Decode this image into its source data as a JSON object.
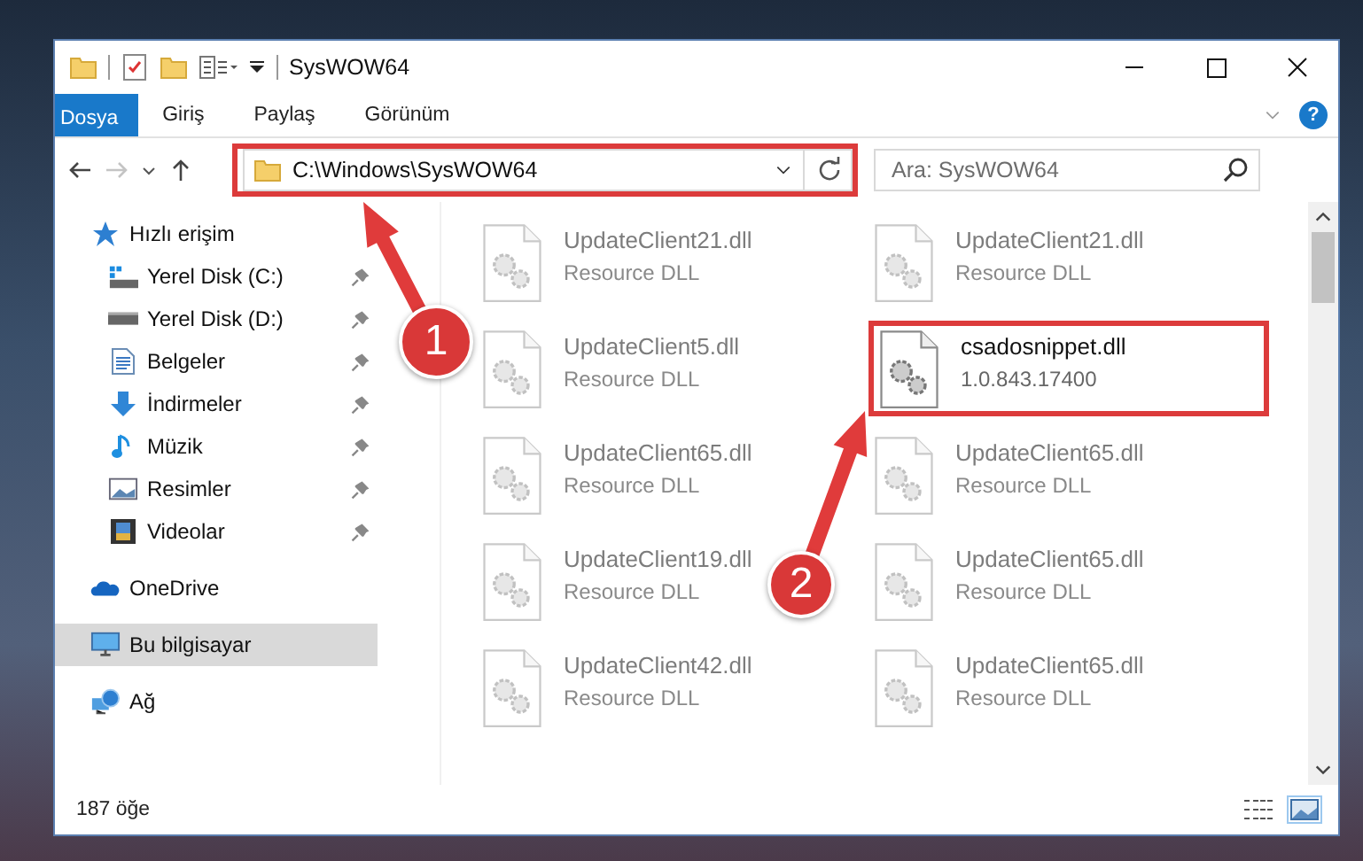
{
  "window": {
    "title": "SysWOW64"
  },
  "ribbon": {
    "tabs": [
      {
        "label": "Dosya",
        "kind": "file",
        "selected": false
      },
      {
        "label": "Giriş",
        "kind": "tab",
        "selected": false
      },
      {
        "label": "Paylaş",
        "kind": "tab",
        "selected": false
      },
      {
        "label": "Görünüm",
        "kind": "tab",
        "selected": false
      }
    ],
    "help_label": "?"
  },
  "address_bar": {
    "path": "C:\\Windows\\SysWOW64",
    "highlighted": true,
    "forward_disabled": true
  },
  "search": {
    "placeholder": "Ara: SysWOW64"
  },
  "sidebar": {
    "items": [
      {
        "label": "Hızlı erişim",
        "kind": "star",
        "selected": false,
        "children": [
          {
            "label": "Yerel Disk (C:)",
            "kind": "drive-c",
            "pinned": true,
            "selected": false
          },
          {
            "label": "Yerel Disk (D:)",
            "kind": "drive",
            "pinned": true,
            "selected": false
          },
          {
            "label": "Belgeler",
            "kind": "document",
            "pinned": true,
            "selected": false
          },
          {
            "label": "İndirmeler",
            "kind": "download",
            "pinned": true,
            "selected": false
          },
          {
            "label": "Müzik",
            "kind": "music",
            "pinned": true,
            "selected": false
          },
          {
            "label": "Resimler",
            "kind": "picture",
            "pinned": true,
            "selected": false
          },
          {
            "label": "Videolar",
            "kind": "video",
            "pinned": true,
            "selected": false
          }
        ]
      },
      {
        "label": "OneDrive",
        "kind": "cloud",
        "selected": false
      },
      {
        "label": "Bu bilgisayar",
        "kind": "computer",
        "selected": true
      },
      {
        "label": "Ağ",
        "kind": "network",
        "selected": false
      }
    ]
  },
  "files": [
    {
      "name": "UpdateClient21.dll",
      "detail": "Resource DLL",
      "blurred": true,
      "highlighted": false
    },
    {
      "name": "UpdateClient21.dll",
      "detail": "Resource DLL",
      "blurred": true,
      "highlighted": false
    },
    {
      "name": "UpdateClient5.dll",
      "detail": "Resource DLL",
      "blurred": true,
      "highlighted": false
    },
    {
      "name": "csadosnippet.dll",
      "detail": "1.0.843.17400",
      "blurred": false,
      "highlighted": true
    },
    {
      "name": "UpdateClient65.dll",
      "detail": "Resource DLL",
      "blurred": true,
      "highlighted": false
    },
    {
      "name": "UpdateClient65.dll",
      "detail": "Resource DLL",
      "blurred": true,
      "highlighted": false
    },
    {
      "name": "UpdateClient19.dll",
      "detail": "Resource DLL",
      "blurred": true,
      "highlighted": false
    },
    {
      "name": "UpdateClient65.dll",
      "detail": "Resource DLL",
      "blurred": true,
      "highlighted": false
    },
    {
      "name": "UpdateClient42.dll",
      "detail": "Resource DLL",
      "blurred": true,
      "highlighted": false
    },
    {
      "name": "UpdateClient65.dll",
      "detail": "Resource DLL",
      "blurred": true,
      "highlighted": false
    }
  ],
  "status_bar": {
    "count": "187 öğe"
  },
  "callouts": [
    {
      "number": "1"
    },
    {
      "number": "2"
    }
  ]
}
